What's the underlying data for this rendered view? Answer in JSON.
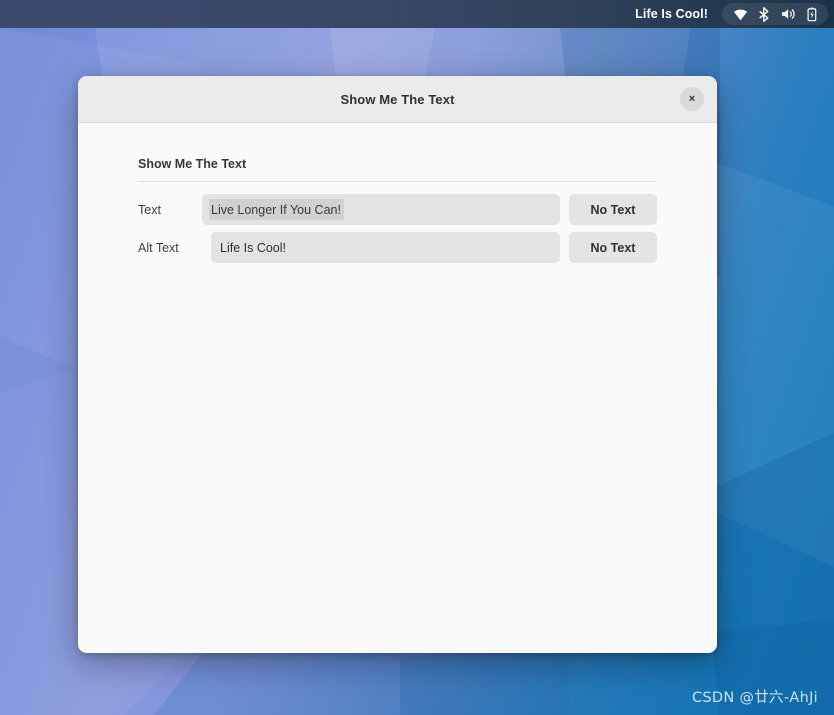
{
  "topbar": {
    "title": "Life Is Cool!",
    "tray_icons": [
      {
        "name": "wifi-icon",
        "label": "wifi"
      },
      {
        "name": "bluetooth-icon",
        "label": "bluetooth"
      },
      {
        "name": "volume-icon",
        "label": "volume"
      },
      {
        "name": "battery-icon",
        "label": "battery"
      }
    ]
  },
  "dialog": {
    "title": "Show Me The Text",
    "close_label": "×",
    "section": {
      "heading": "Show Me The Text",
      "rows": [
        {
          "label": "Text",
          "value": "Live Longer If You Can!",
          "placeholder": "",
          "button_label": "No Text",
          "selected": true
        },
        {
          "label": "Alt Text",
          "value": "Life Is Cool!",
          "placeholder": "",
          "button_label": "No Text",
          "selected": false
        }
      ]
    }
  },
  "watermark": {
    "text": "CSDN @廿六-AhJi"
  },
  "colors": {
    "topbar_bg": "#3a4867",
    "dialog_header_bg": "#ebebeb",
    "dialog_body_bg": "#fafafa",
    "input_bg": "#e3e3e3",
    "button_bg": "#e4e4e4",
    "wallpaper_left": "#7b93de",
    "wallpaper_right": "#1878b9"
  }
}
